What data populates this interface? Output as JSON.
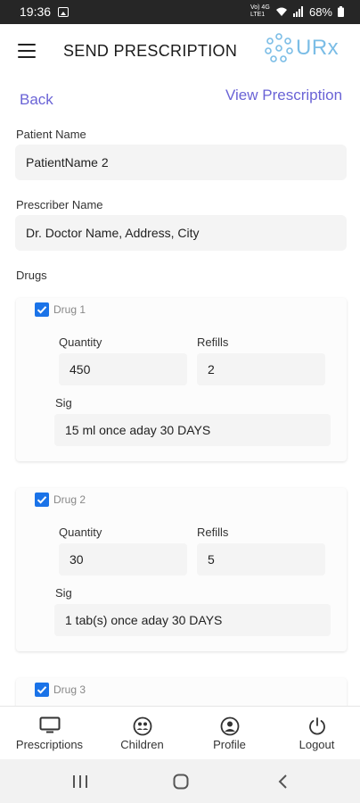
{
  "status_bar": {
    "time": "19:36",
    "network": "Vo) 4G LTE1",
    "battery": "68%"
  },
  "header": {
    "title": "SEND PRESCRIPTION",
    "logo_text": "URx"
  },
  "links": {
    "back": "Back",
    "view_prescription": "View Prescription"
  },
  "patient": {
    "label": "Patient Name",
    "value": "PatientName 2"
  },
  "prescriber": {
    "label": "Prescriber Name",
    "value": "Dr. Doctor Name, Address, City"
  },
  "drugs_label": "Drugs",
  "drugs": [
    {
      "name": "Drug 1",
      "checked": true,
      "quantity_label": "Quantity",
      "quantity": "450",
      "refills_label": "Refills",
      "refills": "2",
      "sig_label": "Sig",
      "sig": "15 ml once aday 30 DAYS"
    },
    {
      "name": "Drug 2",
      "checked": true,
      "quantity_label": "Quantity",
      "quantity": "30",
      "refills_label": "Refills",
      "refills": "5",
      "sig_label": "Sig",
      "sig": "1 tab(s) once aday 30 DAYS"
    },
    {
      "name": "Drug 3",
      "checked": true
    }
  ],
  "bottom_nav": [
    {
      "label": "Prescriptions",
      "icon": "monitor-icon"
    },
    {
      "label": "Children",
      "icon": "children-icon"
    },
    {
      "label": "Profile",
      "icon": "profile-icon"
    },
    {
      "label": "Logout",
      "icon": "power-icon"
    }
  ],
  "colors": {
    "link": "#6a63d6",
    "checkbox": "#1a73e8",
    "logo": "#7bbde6",
    "status_bar": "#262626"
  }
}
